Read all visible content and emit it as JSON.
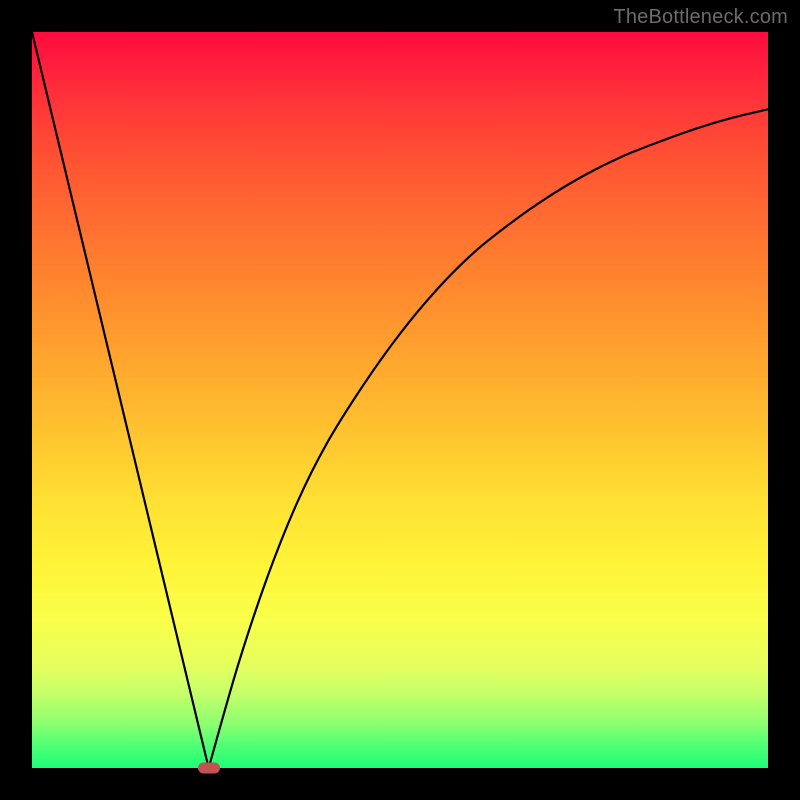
{
  "watermark": "TheBottleneck.com",
  "colors": {
    "frame": "#000000",
    "gradient_top": "#ff0b3f",
    "gradient_bottom": "#1cff77",
    "curve": "#000000",
    "marker": "#c15352",
    "watermark_text": "#6b6b6b"
  },
  "chart_data": {
    "type": "line",
    "title": "",
    "xlabel": "",
    "ylabel": "",
    "xlim": [
      0,
      100
    ],
    "ylim": [
      0,
      100
    ],
    "grid": false,
    "legend": false,
    "series": [
      {
        "name": "left-arm",
        "x": [
          0,
          5,
          10,
          15,
          20,
          24
        ],
        "values": [
          100,
          79.2,
          58.3,
          37.5,
          16.7,
          0
        ]
      },
      {
        "name": "right-arm",
        "x": [
          24,
          28,
          32,
          36,
          40,
          45,
          50,
          55,
          60,
          65,
          70,
          75,
          80,
          85,
          90,
          95,
          100
        ],
        "values": [
          0,
          14,
          26,
          36,
          44,
          52,
          59,
          65,
          70,
          74,
          77.5,
          80.5,
          83,
          85,
          86.8,
          88.3,
          89.5
        ]
      }
    ],
    "marker": {
      "x": 24,
      "y": 0
    },
    "note": "Values are read off the image relative to the plot area; y=0 is the bottom (green) edge, y=100 is the top (red) edge."
  }
}
